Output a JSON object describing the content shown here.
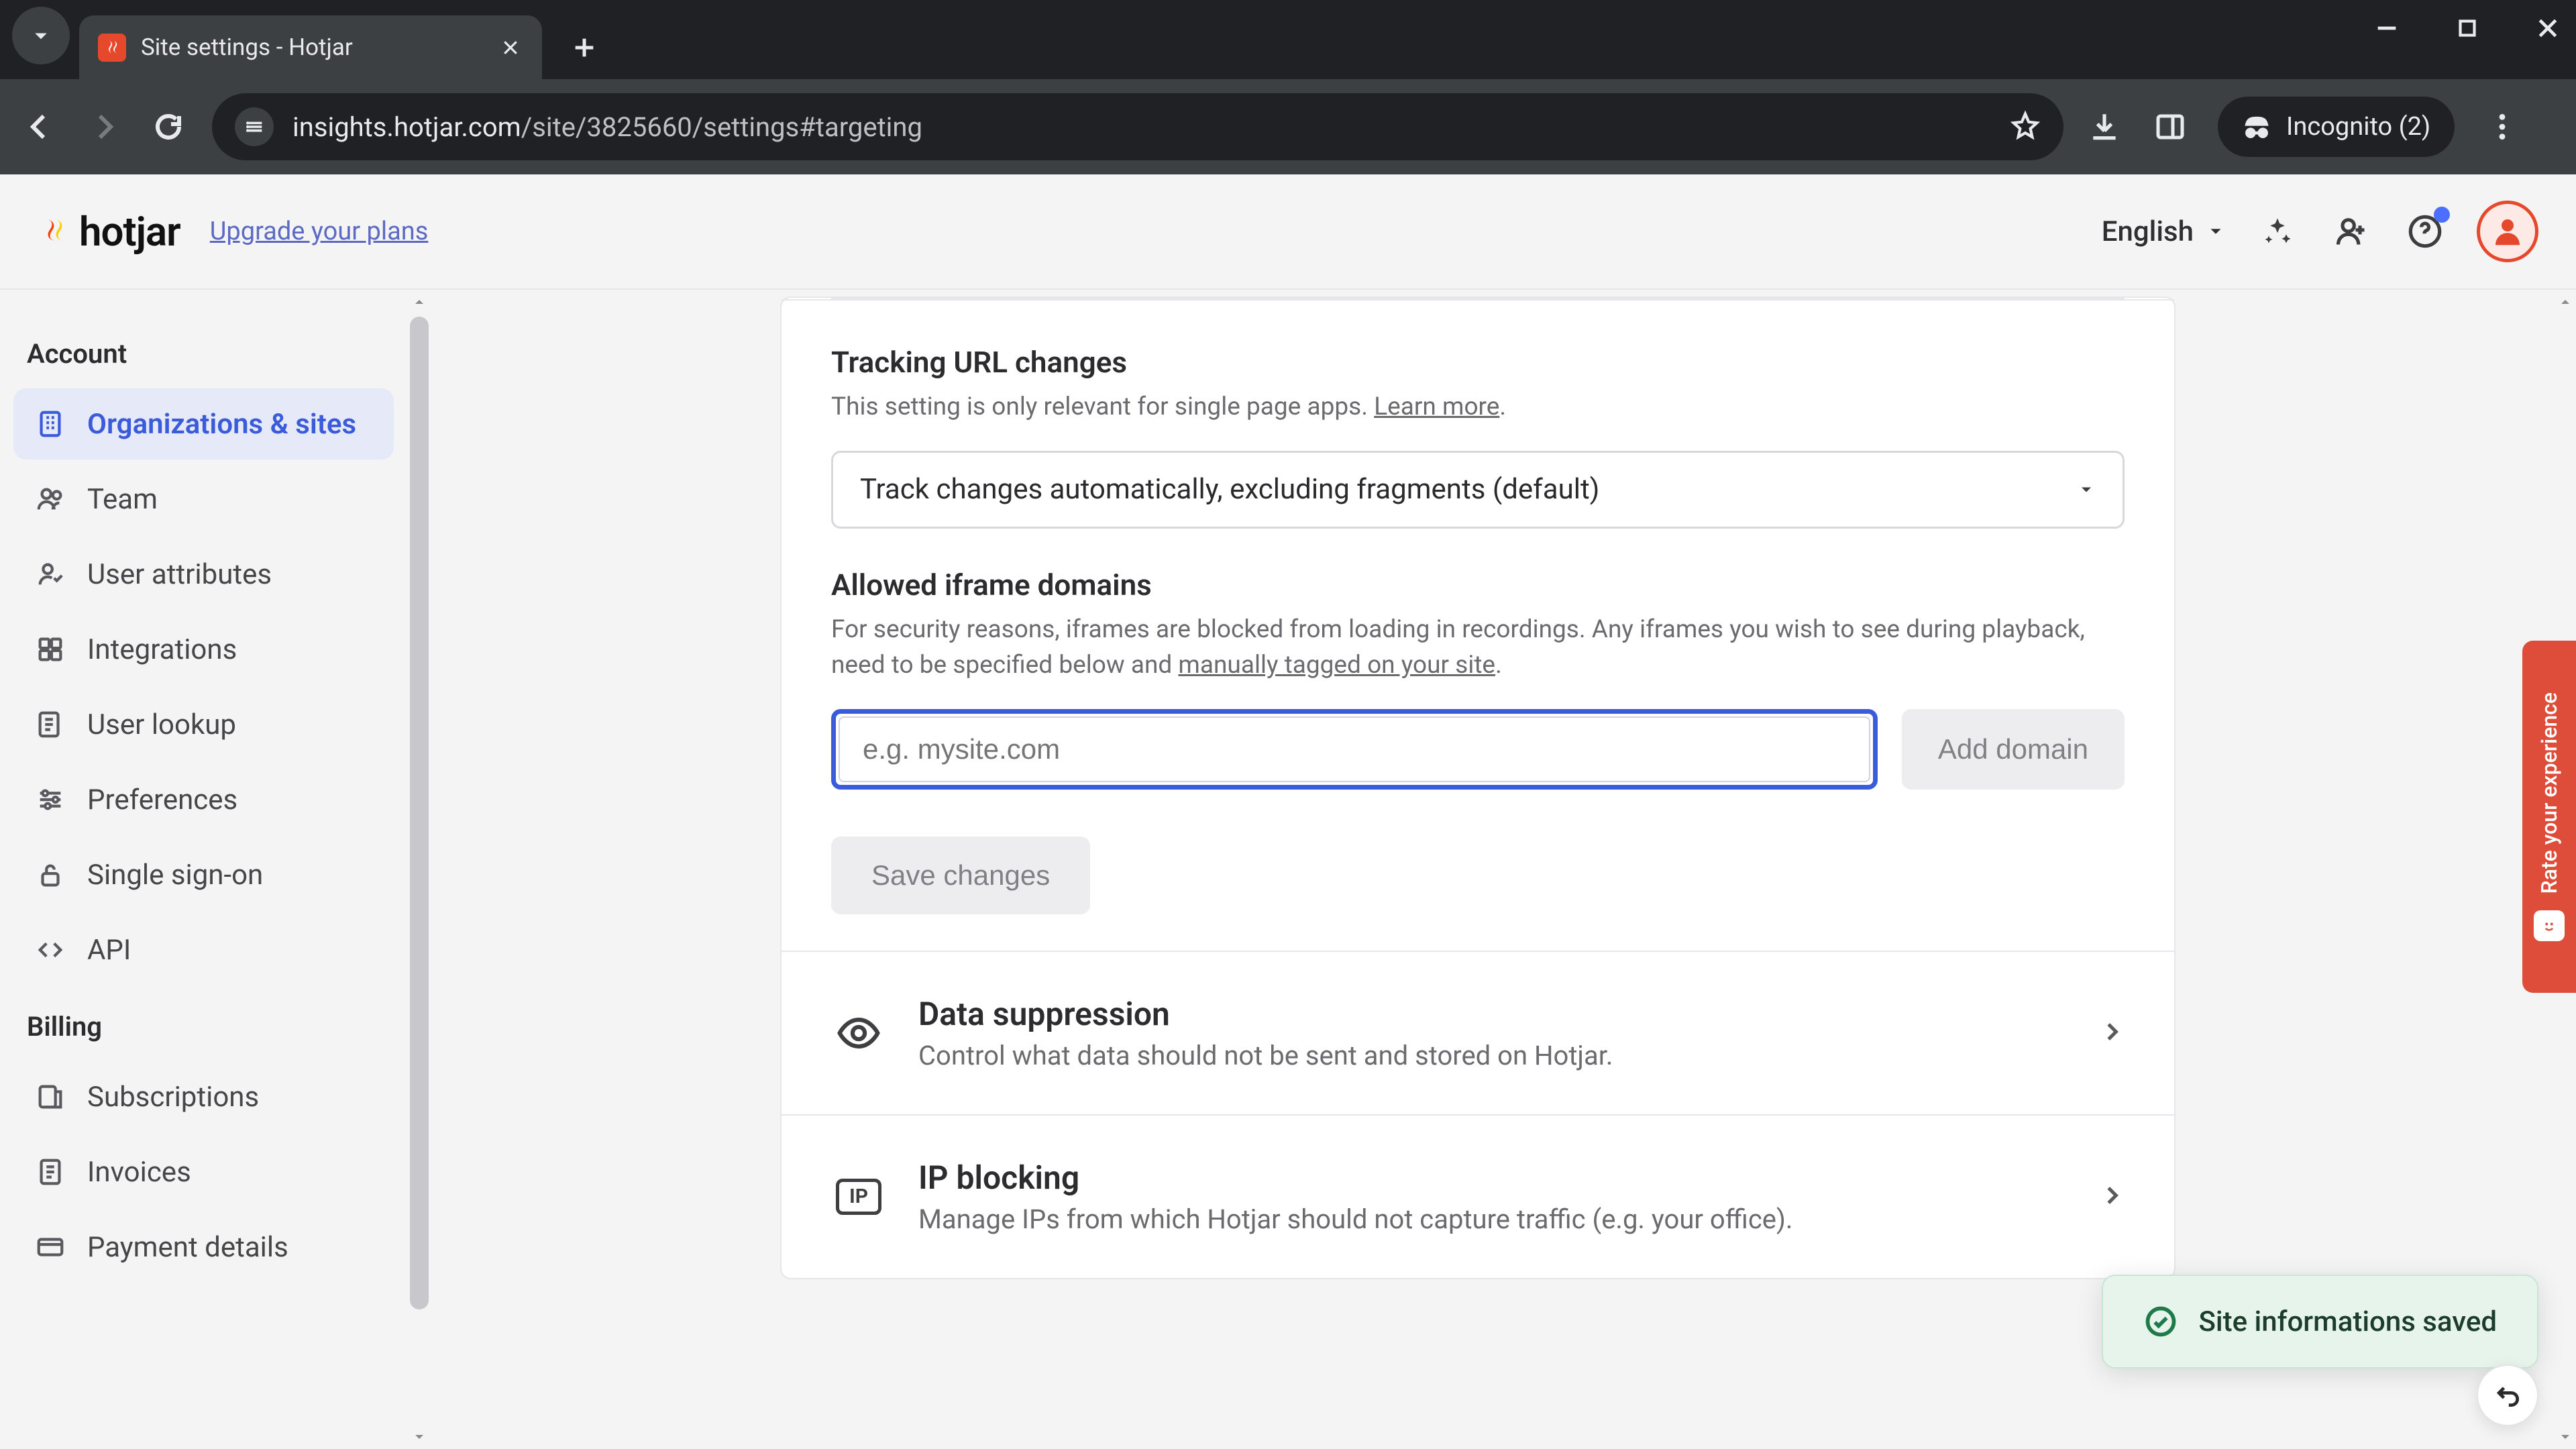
{
  "browser": {
    "tab_title": "Site settings - Hotjar",
    "url_host": "insights.hotjar.com",
    "url_path": "/site/3825660/settings#targeting",
    "incognito_label": "Incognito (2)"
  },
  "header": {
    "brand": "hotjar",
    "upgrade": "Upgrade your plans",
    "language": "English"
  },
  "sidebar": {
    "sections": [
      {
        "heading": "Account",
        "items": [
          {
            "icon": "building-icon",
            "label": "Organizations & sites",
            "active": true
          },
          {
            "icon": "team-icon",
            "label": "Team"
          },
          {
            "icon": "user-attr-icon",
            "label": "User attributes"
          },
          {
            "icon": "integrations-icon",
            "label": "Integrations"
          },
          {
            "icon": "lookup-icon",
            "label": "User lookup"
          },
          {
            "icon": "preferences-icon",
            "label": "Preferences"
          },
          {
            "icon": "lock-icon",
            "label": "Single sign-on"
          },
          {
            "icon": "code-icon",
            "label": "API"
          }
        ]
      },
      {
        "heading": "Billing",
        "items": [
          {
            "icon": "subscription-icon",
            "label": "Subscriptions"
          },
          {
            "icon": "invoice-icon",
            "label": "Invoices"
          },
          {
            "icon": "card-icon",
            "label": "Payment details"
          }
        ]
      }
    ]
  },
  "settings": {
    "tracking": {
      "title": "Tracking URL changes",
      "help_pre": "This setting is only relevant for single page apps. ",
      "help_link": "Learn more",
      "help_post": ".",
      "select_value": "Track changes automatically, excluding fragments (default)"
    },
    "iframe": {
      "title": "Allowed iframe domains",
      "help_pre": "For security reasons, iframes are blocked from loading in recordings. Any iframes you wish to see during playback, need to be specified below and ",
      "help_link": "manually tagged on your site",
      "help_post": ".",
      "placeholder": "e.g. mysite.com",
      "add_btn": "Add domain"
    },
    "save_btn": "Save changes",
    "cards": [
      {
        "id": "data-suppression",
        "icon": "eye-icon",
        "title": "Data suppression",
        "sub": "Control what data should not be sent and stored on Hotjar."
      },
      {
        "id": "ip-blocking",
        "icon": "ip-icon",
        "title": "IP blocking",
        "sub": "Manage IPs from which Hotjar should not capture traffic (e.g. your office)."
      }
    ],
    "ip_badge": "IP"
  },
  "toast": {
    "text": "Site informations saved"
  },
  "feedback": {
    "label": "Rate your experience"
  }
}
